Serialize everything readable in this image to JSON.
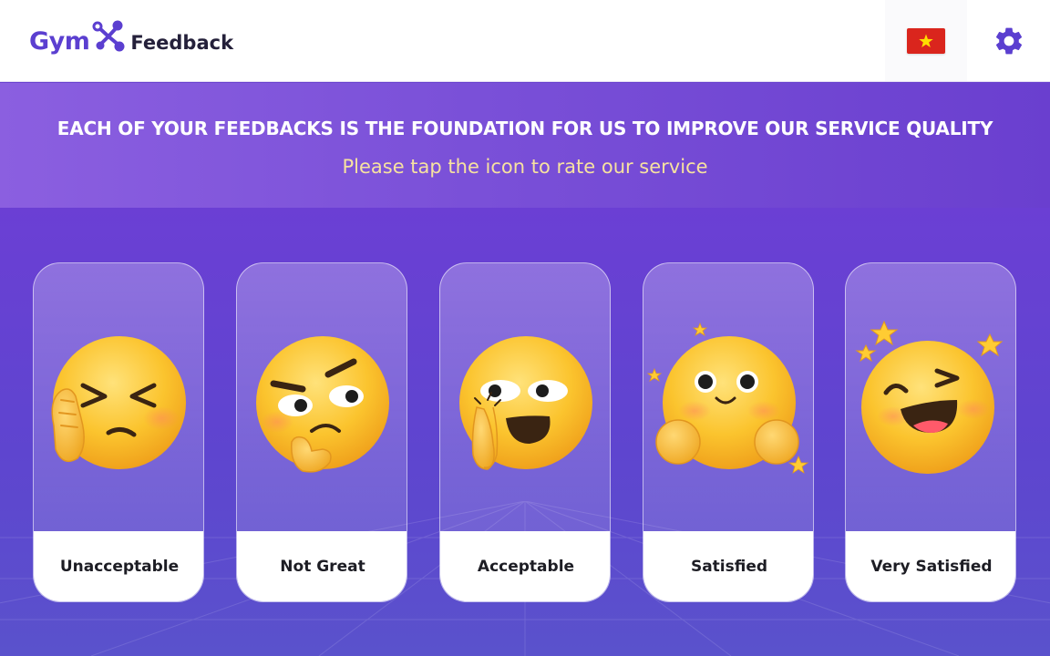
{
  "header": {
    "logo_gym": "Gym",
    "logo_feedback": "Feedback"
  },
  "hero": {
    "headline": "EACH OF YOUR FEEDBACKS IS THE FOUNDATION FOR US TO IMPROVE OUR SERVICE QUALITY",
    "subline": "Please tap the icon to rate our service"
  },
  "ratings": [
    {
      "label": "Unacceptable",
      "icon": "cringing-face-icon"
    },
    {
      "label": "Not Great",
      "icon": "skeptical-face-icon"
    },
    {
      "label": "Acceptable",
      "icon": "pleading-hands-face-icon"
    },
    {
      "label": "Satisfied",
      "icon": "smiling-face-icon"
    },
    {
      "label": "Very Satisfied",
      "icon": "laughing-face-icon"
    }
  ],
  "icons": {
    "language": "vietnam-flag-icon",
    "settings": "gear-icon"
  },
  "colors": {
    "brand": "#5b3fd0",
    "headline": "#ffffff",
    "subline": "#f7e2a0",
    "background": "#6a43cf",
    "emoji": "#fbc42e"
  }
}
